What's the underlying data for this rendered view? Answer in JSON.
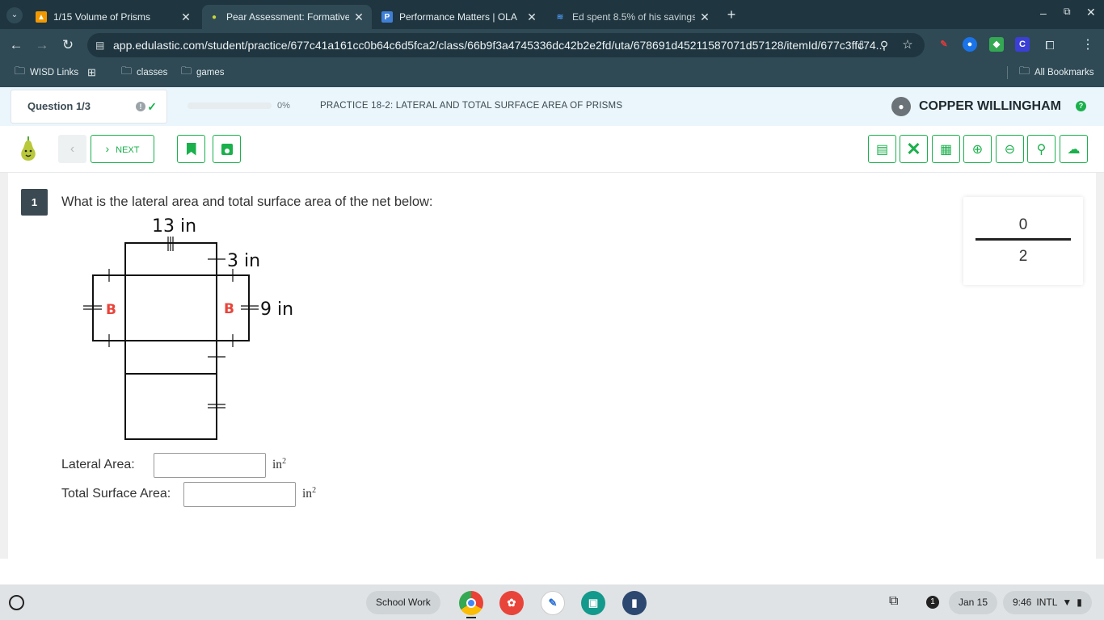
{
  "browser": {
    "tabs": [
      {
        "title": "1/15 Volume of Prisms",
        "icon": "classroom-icon",
        "active": false
      },
      {
        "title": "Pear Assessment: Formative a",
        "icon": "pear-icon",
        "active": true
      },
      {
        "title": "Performance Matters | OLA",
        "icon": "performance-matters-icon",
        "active": false
      },
      {
        "title": "Ed spent 8.5% of his savings o",
        "icon": "search-result-icon",
        "active": false
      }
    ],
    "url": "app.edulastic.com/student/practice/677c41a161cc0b64c6d5fca2/class/66b9f3a4745336dc42b2e2fd/uta/678691d45211587071d57128/itemId/677c3ffc74...",
    "bookmarks": [
      {
        "label": "WISD Links",
        "icon": "folder-icon"
      },
      {
        "label": "",
        "icon": "apps-grid-icon"
      },
      {
        "label": "classes",
        "icon": "folder-icon"
      },
      {
        "label": "games",
        "icon": "folder-icon"
      }
    ],
    "all_bookmarks": "All Bookmarks"
  },
  "header": {
    "question_selector": "Question 1/3",
    "progress_text": "0%",
    "progress_value": 0,
    "practice_title": "PRACTICE 18-2: LATERAL AND TOTAL SURFACE AREA OF PRISMS",
    "user_name": "COPPER WILLINGHAM",
    "help": "?"
  },
  "toolbar": {
    "next_label": "NEXT",
    "tools": [
      "notepad-icon",
      "eliminate-icon",
      "calculator-icon",
      "zoom-in-icon",
      "zoom-out-icon",
      "magnifier-icon",
      "upload-icon"
    ]
  },
  "question": {
    "number": "1",
    "text": "What is the lateral area and total surface area of the net below:",
    "figure": {
      "length_label": "13 in",
      "width_label": "3 in",
      "height_label": "9 in",
      "base_label_left": "B",
      "base_label_right": "B"
    },
    "lateral_area_label": "Lateral Area:",
    "total_area_label": "Total Surface Area:",
    "lateral_area_value": "",
    "total_area_value": "",
    "unit": "in",
    "unit_exp": "2"
  },
  "score": {
    "earned": "0",
    "total": "2"
  },
  "shelf": {
    "school_work": "School Work",
    "apps": [
      "chrome-icon",
      "paint-icon",
      "pen-icon",
      "classroom-icon",
      "analytics-icon"
    ],
    "notification_count": "1",
    "date": "Jan 15",
    "time": "9:46",
    "locale": "INTL"
  },
  "colors": {
    "accent": "#1ab04c",
    "chrome_dark": "#1f3640",
    "chrome_mid": "#2f4a55",
    "base_label": "#e8443a"
  }
}
